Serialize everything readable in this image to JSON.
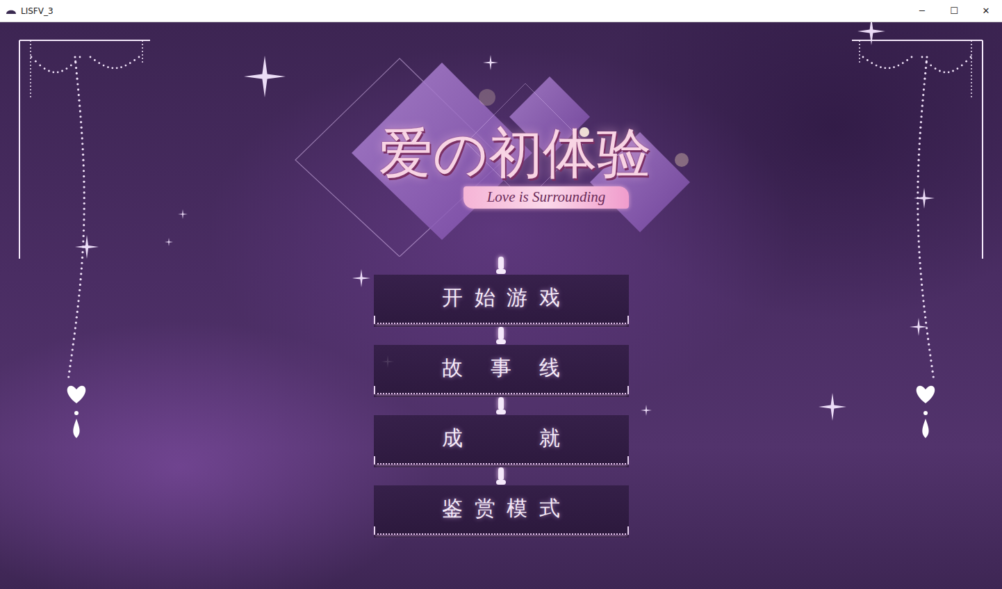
{
  "window": {
    "title": "LISFV_3",
    "controls": [
      "─",
      "☐",
      "✕"
    ]
  },
  "logo": {
    "title": "爱の初体验",
    "subtitle": "Love is Surrounding"
  },
  "menu": [
    {
      "label": "开始游戏",
      "selected": false
    },
    {
      "label": "故事线",
      "selected": false
    },
    {
      "label": "成就",
      "selected": false
    },
    {
      "label": "鉴赏模式",
      "selected": false
    }
  ]
}
